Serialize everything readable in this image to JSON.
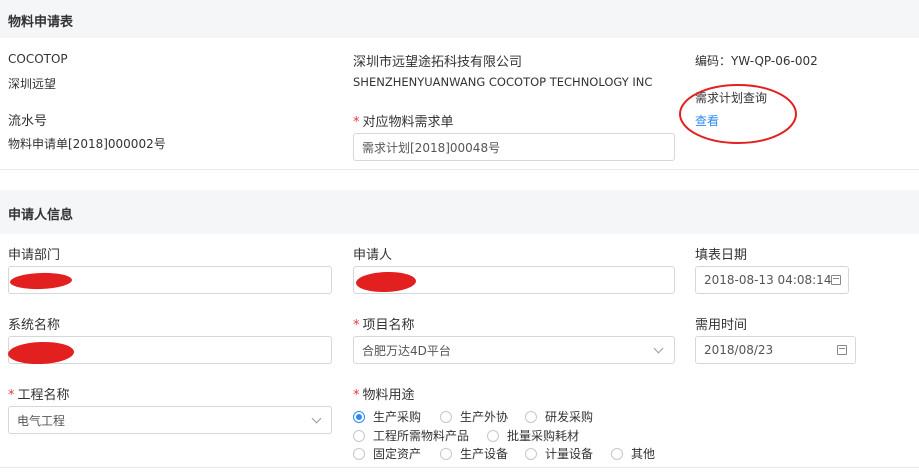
{
  "material_form": {
    "section_title": "物料申请表",
    "company_short_en": "COCOTOP",
    "company_short_cn": "深圳远望",
    "company_full_cn": "深圳市远望途拓科技有限公司",
    "company_full_en": "SHENZHENYUANWANG COCOTOP TECHNOLOGY INC",
    "code_label": "编码：YW-QP-06-002",
    "serial_label": "流水号",
    "serial_value": "物料申请单[2018]000002号",
    "demand_label": "对应物料需求单",
    "demand_value": "需求计划[2018]00048号",
    "plan_query_label": "需求计划查询",
    "plan_query_link": "查看"
  },
  "applicant": {
    "section_title": "申请人信息",
    "dept_label": "申请部门",
    "applicant_label": "申请人",
    "fill_date_label": "填表日期",
    "fill_date_value": "2018-08-13 04:08:14",
    "system_label": "系统名称",
    "project_label": "项目名称",
    "project_value": "合肥万达4D平台",
    "need_time_label": "需用时间",
    "need_time_value": "2018/08/23",
    "engineering_label": "工程名称",
    "engineering_value": "电气工程",
    "usage_label": "物料用途",
    "usage_options": [
      "生产采购",
      "生产外协",
      "研发采购",
      "工程所需物料产品",
      "批量采购耗材",
      "固定资产",
      "生产设备",
      "计量设备",
      "其他"
    ],
    "usage_selected": "生产采购"
  },
  "colors": {
    "accent": "#2d8cf0",
    "required": "#e4393c",
    "annotation": "#e32020",
    "header_bg": "#f5f6f8"
  }
}
